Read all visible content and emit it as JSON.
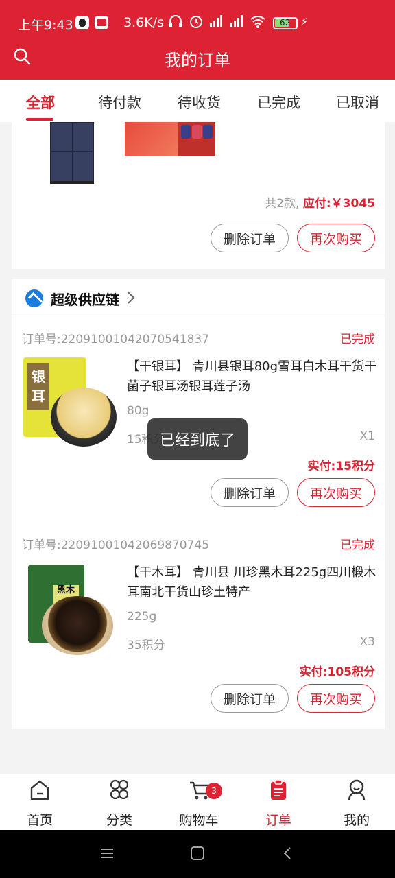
{
  "status_bar": {
    "time": "上午9:43",
    "speed": "3.6K/s",
    "battery": "62"
  },
  "header": {
    "title": "我的订单"
  },
  "tabs": [
    {
      "label": "全部",
      "active": true
    },
    {
      "label": "待付款"
    },
    {
      "label": "待收货"
    },
    {
      "label": "已完成"
    },
    {
      "label": "已取消"
    }
  ],
  "order_top": {
    "summary_count": "共2款,",
    "summary_pay": "应付:￥3045",
    "delete_label": "删除订单",
    "rebuy_label": "再次购买"
  },
  "store": {
    "name": "超级供应链"
  },
  "orders": [
    {
      "order_no_label": "订单号:",
      "order_no": "22091001042070541837",
      "status": "已完成",
      "title": "【干银耳】 青川县银耳80g雪耳白木耳干货干菌子银耳汤银耳莲子汤",
      "spec": "80g",
      "points": "15积分",
      "qty": "X1",
      "paid": "实付:15积分",
      "delete_label": "删除订单",
      "rebuy_label": "再次购买",
      "pack_text": "银耳"
    },
    {
      "order_no_label": "订单号:",
      "order_no": "22091001042069870745",
      "status": "已完成",
      "title": "【干木耳】 青川县 川珍黑木耳225g四川椴木耳南北干货山珍土特产",
      "spec": "225g",
      "points": "35积分",
      "qty": "X3",
      "paid": "实付:105积分",
      "delete_label": "删除订单",
      "rebuy_label": "再次购买",
      "pack_text": "黑木"
    }
  ],
  "toast": "已经到底了",
  "bottom_nav": [
    {
      "label": "首页",
      "icon": "home-icon"
    },
    {
      "label": "分类",
      "icon": "category-icon"
    },
    {
      "label": "购物车",
      "icon": "cart-icon",
      "badge": "3"
    },
    {
      "label": "订单",
      "icon": "order-icon",
      "active": true
    },
    {
      "label": "我的",
      "icon": "profile-icon"
    }
  ],
  "colors": {
    "brand": "#dd2233",
    "muted": "#999999"
  }
}
